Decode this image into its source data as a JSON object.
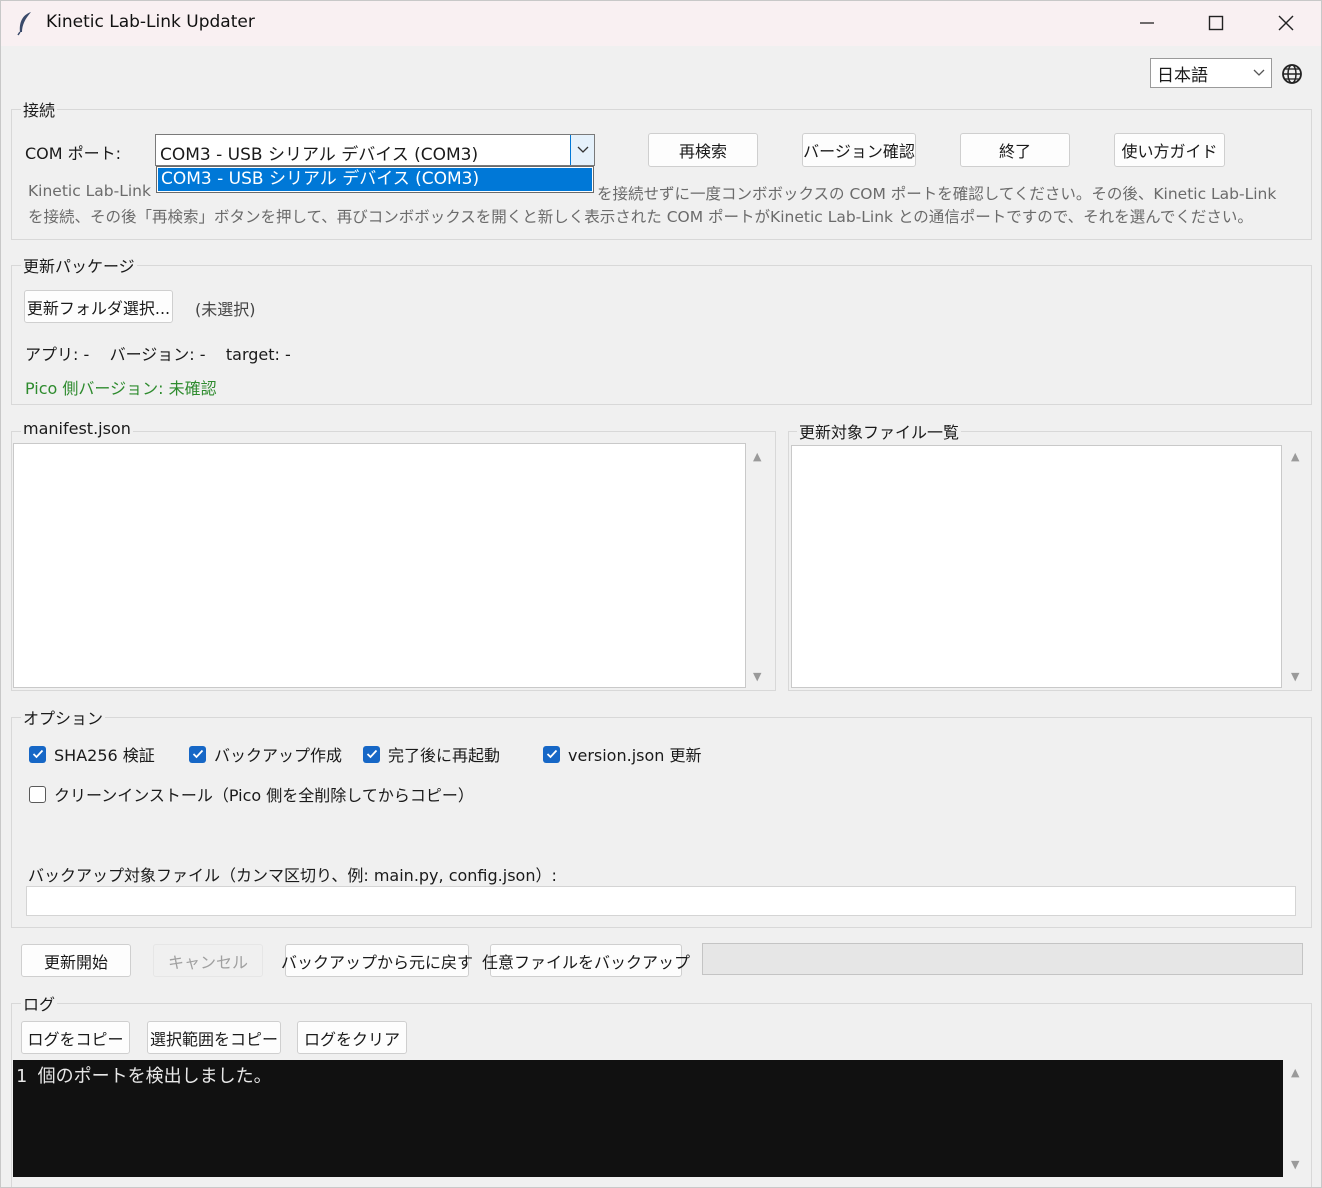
{
  "window": {
    "title": "Kinetic Lab-Link Updater"
  },
  "language": {
    "selected": "日本語"
  },
  "connection": {
    "group_label": "接続",
    "com_label": "COM ポート:",
    "com_value": "COM3  -  USB シリアル デバイス (COM3)",
    "dropdown_option": "COM3  -  USB シリアル デバイス (COM3)",
    "rescan": "再検索",
    "version_check": "バージョン確認",
    "exit": "終了",
    "guide": "使い方ガイド",
    "hint_line1_left": "Kinetic Lab-Link",
    "hint_line1_right": "を接続せずに一度コンボボックスの COM ポートを確認してください。その後、Kinetic Lab-Link",
    "hint_line2": "を接続、その後「再検索」ボタンを押して、再びコンボボックスを開くと新しく表示された COM ポートがKinetic Lab-Link との通信ポートですので、それを選んでください。"
  },
  "package": {
    "group_label": "更新パッケージ",
    "select_folder": "更新フォルダ選択...",
    "unselected": "(未選択)",
    "info": "アプリ: -    バージョン: -    target: -",
    "pico_version": "Pico 側バージョン: 未確認"
  },
  "manifest": {
    "label": "manifest.json"
  },
  "filelist": {
    "label": "更新対象ファイル一覧"
  },
  "options": {
    "group_label": "オプション",
    "sha256": "SHA256 検証",
    "backup": "バックアップ作成",
    "restart": "完了後に再起動",
    "version_json": "version.json 更新",
    "clean_install": "クリーンインストール（Pico 側を全削除してからコピー）",
    "backup_files_label": "バックアップ対象ファイル（カンマ区切り、例: main.py, config.json）:",
    "backup_files_value": ""
  },
  "actions": {
    "start": "更新開始",
    "cancel": "キャンセル",
    "restore": "バックアップから元に戻す",
    "backup_any": "任意ファイルをバックアップ",
    "progress": 0
  },
  "log": {
    "group_label": "ログ",
    "copy": "ログをコピー",
    "copy_selection": "選択範囲をコピー",
    "clear": "ログをクリア",
    "content": "1 個のポートを検出しました。"
  },
  "colors": {
    "accent": "#0078d7",
    "checkbox": "#1667c6",
    "pico_text": "#2e8b2e",
    "log_bg": "#111111"
  }
}
